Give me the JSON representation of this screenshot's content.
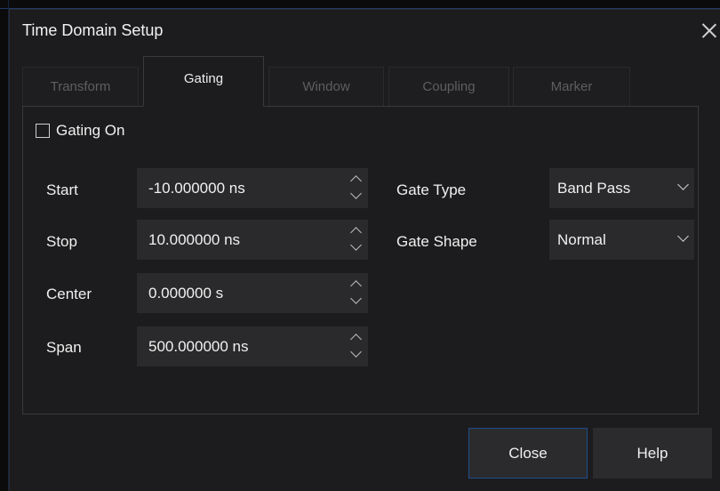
{
  "dialog": {
    "title": "Time Domain Setup"
  },
  "tabs": [
    {
      "label": "Transform",
      "active": false
    },
    {
      "label": "Gating",
      "active": true
    },
    {
      "label": "Window",
      "active": false
    },
    {
      "label": "Coupling",
      "active": false
    },
    {
      "label": "Marker",
      "active": false
    }
  ],
  "gating": {
    "gating_on": {
      "label": "Gating On",
      "checked": false
    },
    "start": {
      "label": "Start",
      "value": "-10.000000 ns"
    },
    "stop": {
      "label": "Stop",
      "value": "10.000000 ns"
    },
    "center": {
      "label": "Center",
      "value": "0.000000 s"
    },
    "span": {
      "label": "Span",
      "value": "500.000000 ns"
    },
    "gate_type": {
      "label": "Gate Type",
      "value": "Band Pass"
    },
    "gate_shape": {
      "label": "Gate Shape",
      "value": "Normal"
    }
  },
  "buttons": {
    "close": "Close",
    "help": "Help"
  },
  "icons": {
    "dialog_close": "close-icon",
    "spin_up": "chevron-up-icon",
    "spin_down": "chevron-down-icon",
    "dropdown": "chevron-down-icon"
  },
  "colors": {
    "dialog_bg": "#1c1c1e",
    "field_bg": "#2a2a2c",
    "primary_border": "#1f4d8c"
  }
}
